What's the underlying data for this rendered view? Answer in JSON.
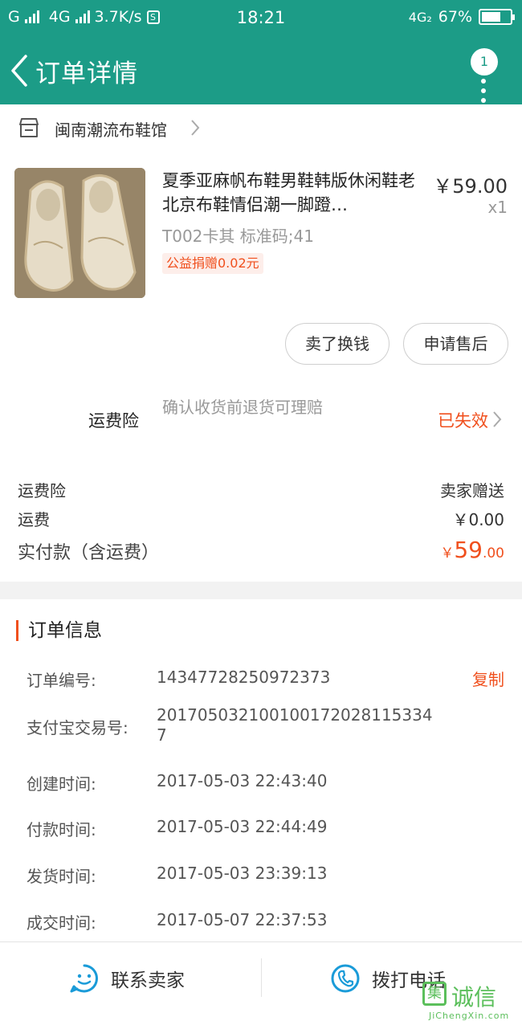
{
  "status_bar": {
    "carrier1": "G",
    "carrier2": "4G",
    "speed": "3.7K/s",
    "time": "18:21",
    "network": "4G₂",
    "battery": "67%",
    "battery_level": 0.67
  },
  "header": {
    "title": "订单详情",
    "badge_count": "1"
  },
  "shop": {
    "name": "闽南潮流布鞋馆"
  },
  "product": {
    "title": "夏季亚麻帆布鞋男鞋韩版休闲鞋老北京布鞋情侣潮一脚蹬…",
    "price": "￥59.00",
    "qty": "x1",
    "sku": "T002卡其  标准码;41",
    "charity": "公益捐赠0.02元"
  },
  "actions": {
    "sell": "卖了换钱",
    "after_sale": "申请售后"
  },
  "insurance": {
    "label": "运费险",
    "desc": "确认收货前退货可理赔",
    "status": "已失效"
  },
  "fees": {
    "ins_label": "运费险",
    "ins_value": "卖家赠送",
    "ship_label": "运费",
    "ship_value": "￥0.00",
    "total_label": "实付款（含运费）",
    "total_currency": "￥",
    "total_int": "59",
    "total_dec": ".00"
  },
  "order_info": {
    "heading": "订单信息",
    "copy": "复制",
    "rows": [
      {
        "key": "订单编号:",
        "value": "14347728250972373"
      },
      {
        "key": "支付宝交易号:",
        "value": "2017050321001001720281153347"
      },
      {
        "key": "创建时间:",
        "value": "2017-05-03 22:43:40"
      },
      {
        "key": "付款时间:",
        "value": "2017-05-03 22:44:49"
      },
      {
        "key": "发货时间:",
        "value": "2017-05-03 23:39:13"
      },
      {
        "key": "成交时间:",
        "value": "2017-05-07 22:37:53"
      }
    ]
  },
  "bottom": {
    "contact": "联系卖家",
    "call": "拨打电话"
  },
  "watermark": {
    "box": "集",
    "text": "诚信",
    "sub": "JiChengXin.com"
  },
  "colors": {
    "primary": "#1c9c87",
    "accent": "#f0501e",
    "icon_blue": "#1a9bd8"
  }
}
